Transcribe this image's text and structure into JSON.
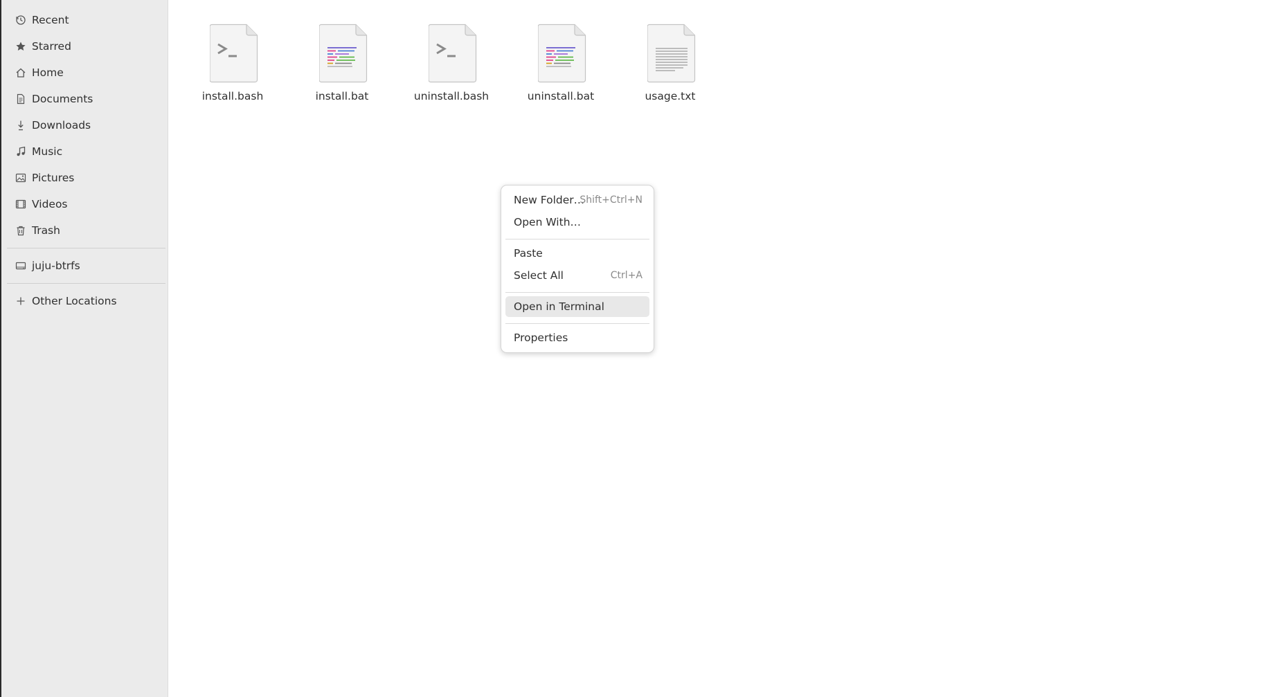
{
  "sidebar": {
    "items": [
      {
        "label": "Recent",
        "icon": "clock-icon"
      },
      {
        "label": "Starred",
        "icon": "star-icon"
      },
      {
        "label": "Home",
        "icon": "home-icon"
      },
      {
        "label": "Documents",
        "icon": "document-icon"
      },
      {
        "label": "Downloads",
        "icon": "download-icon"
      },
      {
        "label": "Music",
        "icon": "music-icon"
      },
      {
        "label": "Pictures",
        "icon": "picture-icon"
      },
      {
        "label": "Videos",
        "icon": "video-icon"
      },
      {
        "label": "Trash",
        "icon": "trash-icon"
      }
    ],
    "volumes": [
      {
        "label": "juju-btrfs",
        "icon": "drive-icon"
      }
    ],
    "other": {
      "label": "Other Locations",
      "icon": "plus-icon"
    }
  },
  "files": [
    {
      "name": "install.bash",
      "icon": "script-file-icon"
    },
    {
      "name": "install.bat",
      "icon": "code-file-icon"
    },
    {
      "name": "uninstall.bash",
      "icon": "script-file-icon"
    },
    {
      "name": "uninstall.bat",
      "icon": "code-file-icon"
    },
    {
      "name": "usage.txt",
      "icon": "text-file-icon"
    }
  ],
  "context_menu": {
    "new_folder": {
      "label": "New Folder…",
      "shortcut": "Shift+Ctrl+N"
    },
    "open_with": {
      "label": "Open With…"
    },
    "paste": {
      "label": "Paste"
    },
    "select_all": {
      "label": "Select All",
      "shortcut": "Ctrl+A"
    },
    "open_terminal": {
      "label": "Open in Terminal"
    },
    "properties": {
      "label": "Properties"
    }
  },
  "colors": {
    "sidebar_bg": "#ebebeb",
    "menu_hover": "#e8e8e8",
    "text": "#303030"
  }
}
